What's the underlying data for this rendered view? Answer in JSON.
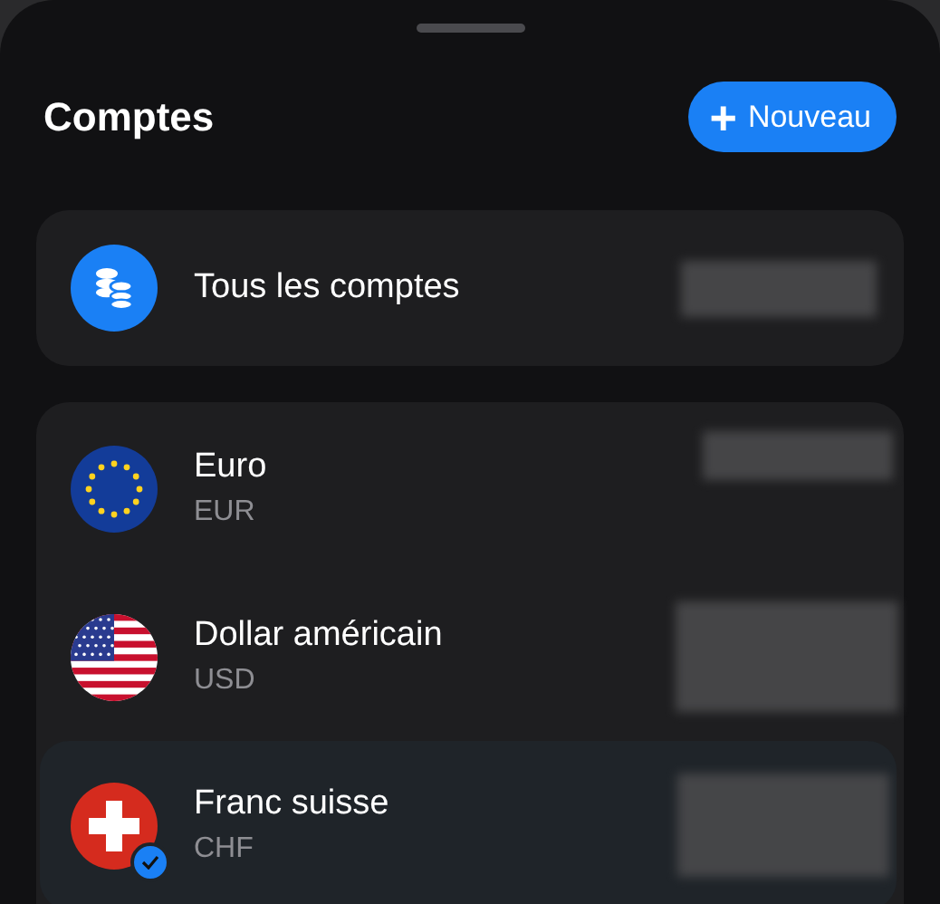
{
  "header": {
    "title": "Comptes",
    "new_button": {
      "icon": "+",
      "label": "Nouveau"
    }
  },
  "all_accounts": {
    "label": "Tous les comptes"
  },
  "accounts": [
    {
      "name": "Euro",
      "code": "EUR",
      "kind": "eu",
      "selected": false
    },
    {
      "name": "Dollar américain",
      "code": "USD",
      "kind": "us",
      "selected": false
    },
    {
      "name": "Franc suisse",
      "code": "CHF",
      "kind": "ch",
      "selected": true
    }
  ]
}
